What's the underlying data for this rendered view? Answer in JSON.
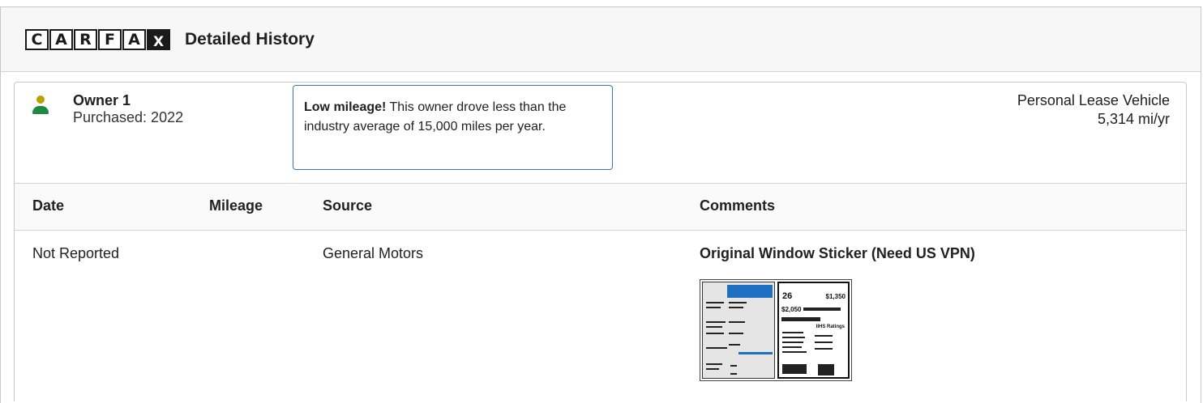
{
  "header": {
    "logo_letters": [
      "C",
      "A",
      "R",
      "F",
      "A",
      "X"
    ],
    "title": "Detailed History"
  },
  "owner": {
    "name": "Owner 1",
    "purchased": "Purchased: 2022",
    "callout_bold": "Low mileage!",
    "callout_text": " This owner drove less than the industry average of 15,000 miles per year.",
    "vehicle_type": "Personal Lease Vehicle",
    "miles_per_year": "5,314 mi/yr",
    "icon_colors": {
      "head": "#b7a300",
      "body": "#1c8a3f"
    }
  },
  "table": {
    "headers": [
      "Date",
      "Mileage",
      "Source",
      "Comments"
    ],
    "rows": [
      {
        "date": "Not Reported",
        "mileage": "",
        "source": "General Motors",
        "comment": "Original Window Sticker (Need US VPN)",
        "sticker": {
          "mpg": "26",
          "mpg_unit": "MPG",
          "cost_top": "$1,350",
          "cost_bottom": "$2,050",
          "ratings": "IIHS Ratings"
        }
      }
    ]
  },
  "colors": {
    "accent_blue": "#3777bc"
  }
}
